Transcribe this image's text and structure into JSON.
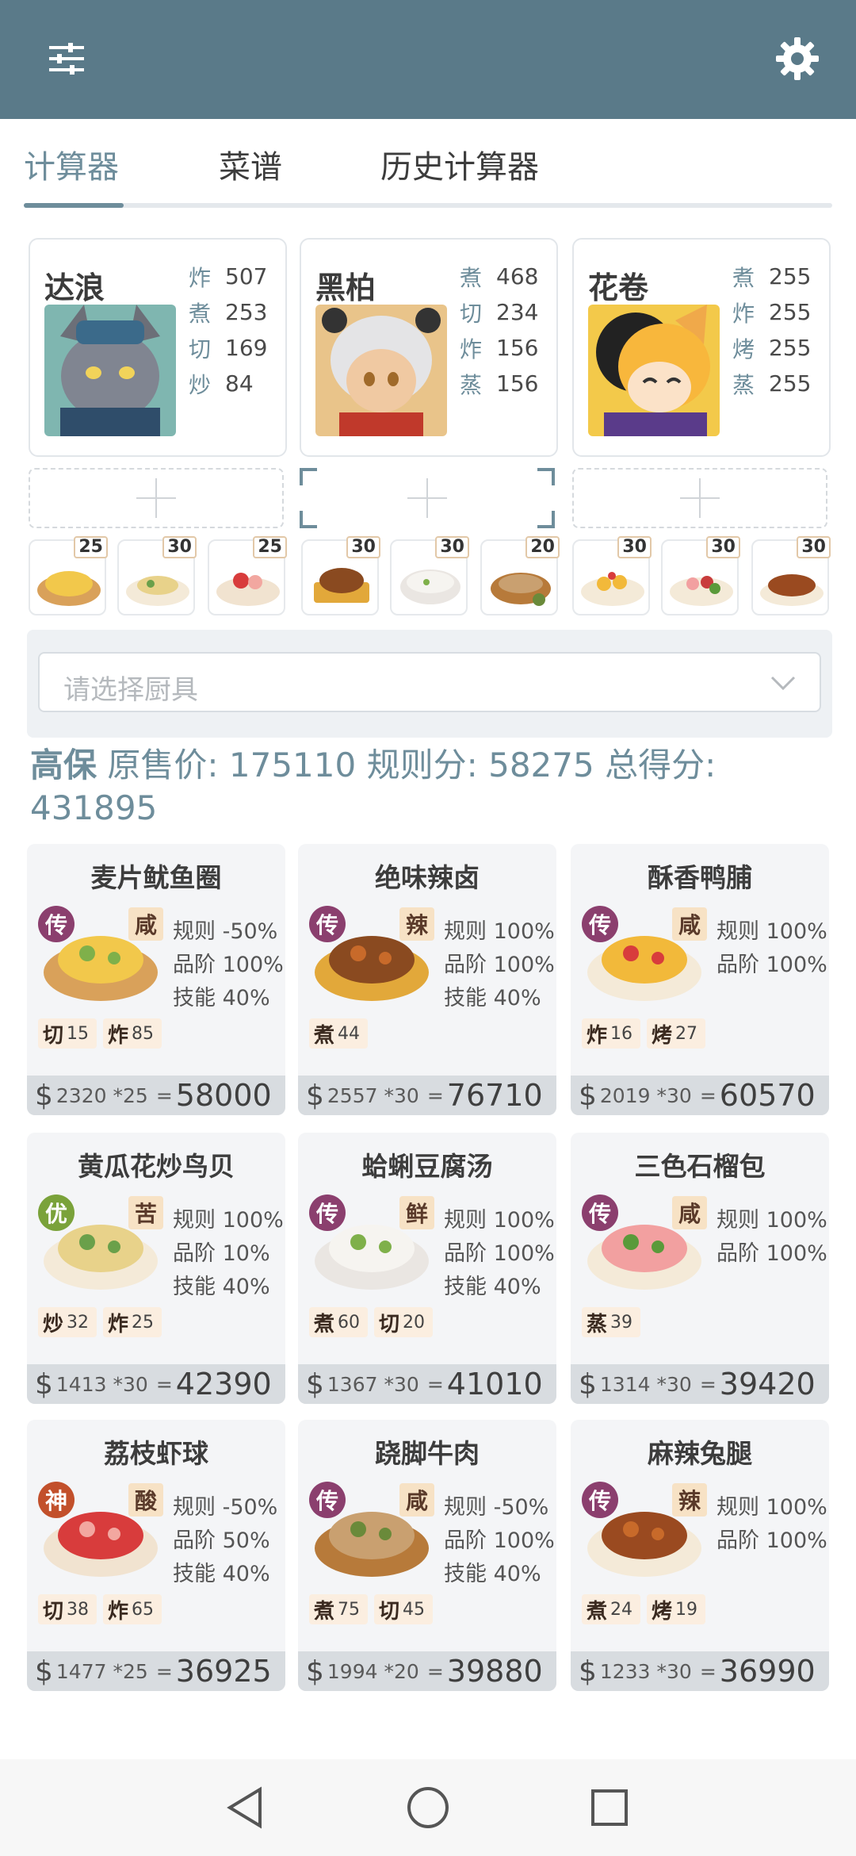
{
  "tabs": [
    {
      "label": "计算器"
    },
    {
      "label": "菜谱"
    },
    {
      "label": "历史计算器"
    }
  ],
  "chefs": [
    {
      "name": "达浪",
      "stats": [
        {
          "k": "炸",
          "v": "507"
        },
        {
          "k": "煮",
          "v": "253"
        },
        {
          "k": "切",
          "v": "169"
        },
        {
          "k": "炒",
          "v": "84"
        }
      ]
    },
    {
      "name": "黑柏",
      "stats": [
        {
          "k": "煮",
          "v": "468"
        },
        {
          "k": "切",
          "v": "234"
        },
        {
          "k": "炸",
          "v": "156"
        },
        {
          "k": "蒸",
          "v": "156"
        }
      ]
    },
    {
      "name": "花卷",
      "stats": [
        {
          "k": "煮",
          "v": "255"
        },
        {
          "k": "炸",
          "v": "255"
        },
        {
          "k": "烤",
          "v": "255"
        },
        {
          "k": "蒸",
          "v": "255"
        }
      ]
    }
  ],
  "dish_counts": [
    "25",
    "30",
    "25",
    "30",
    "30",
    "20",
    "30",
    "30",
    "30"
  ],
  "select": {
    "placeholder": "请选择厨具"
  },
  "summary": {
    "level": "高保",
    "orig_label": "原售价:",
    "orig_value": "175110",
    "rule_label": "规则分:",
    "rule_value": "58275",
    "total_label": "总得分:",
    "total_value": "431895"
  },
  "recipes": [
    {
      "title": "麦片鱿鱼圈",
      "rarity": "传",
      "flavor": "咸",
      "rules": [
        "规则 -50%",
        "品阶 100%",
        "技能 40%"
      ],
      "skills": [
        {
          "k": "切",
          "v": "15"
        },
        {
          "k": "炸",
          "v": "85"
        }
      ],
      "dollar": "$",
      "price": "2320",
      "qty": "*25",
      "eq": "=",
      "total": "58000"
    },
    {
      "title": "绝味辣卤",
      "rarity": "传",
      "flavor": "辣",
      "rules": [
        "规则 100%",
        "品阶 100%",
        "技能 40%"
      ],
      "skills": [
        {
          "k": "煮",
          "v": "44"
        }
      ],
      "dollar": "$",
      "price": "2557",
      "qty": "*30",
      "eq": "=",
      "total": "76710"
    },
    {
      "title": "酥香鸭脯",
      "rarity": "传",
      "flavor": "咸",
      "rules": [
        "规则 100%",
        "品阶 100%"
      ],
      "skills": [
        {
          "k": "炸",
          "v": "16"
        },
        {
          "k": "烤",
          "v": "27"
        }
      ],
      "dollar": "$",
      "price": "2019",
      "qty": "*30",
      "eq": "=",
      "total": "60570"
    },
    {
      "title": "黄瓜花炒鸟贝",
      "rarity": "优",
      "flavor": "苦",
      "rules": [
        "规则 100%",
        "品阶 10%",
        "技能 40%"
      ],
      "skills": [
        {
          "k": "炒",
          "v": "32"
        },
        {
          "k": "炸",
          "v": "25"
        }
      ],
      "dollar": "$",
      "price": "1413",
      "qty": "*30",
      "eq": "=",
      "total": "42390"
    },
    {
      "title": "蛤蜊豆腐汤",
      "rarity": "传",
      "flavor": "鲜",
      "rules": [
        "规则 100%",
        "品阶 100%",
        "技能 40%"
      ],
      "skills": [
        {
          "k": "煮",
          "v": "60"
        },
        {
          "k": "切",
          "v": "20"
        }
      ],
      "dollar": "$",
      "price": "1367",
      "qty": "*30",
      "eq": "=",
      "total": "41010"
    },
    {
      "title": "三色石榴包",
      "rarity": "传",
      "flavor": "咸",
      "rules": [
        "规则 100%",
        "品阶 100%"
      ],
      "skills": [
        {
          "k": "蒸",
          "v": "39"
        }
      ],
      "dollar": "$",
      "price": "1314",
      "qty": "*30",
      "eq": "=",
      "total": "39420"
    },
    {
      "title": "荔枝虾球",
      "rarity": "神",
      "flavor": "酸",
      "rules": [
        "规则 -50%",
        "品阶 50%",
        "技能 40%"
      ],
      "skills": [
        {
          "k": "切",
          "v": "38"
        },
        {
          "k": "炸",
          "v": "65"
        }
      ],
      "dollar": "$",
      "price": "1477",
      "qty": "*25",
      "eq": "=",
      "total": "36925"
    },
    {
      "title": "跷脚牛肉",
      "rarity": "传",
      "flavor": "咸",
      "rules": [
        "规则 -50%",
        "品阶 100%",
        "技能 40%"
      ],
      "skills": [
        {
          "k": "煮",
          "v": "75"
        },
        {
          "k": "切",
          "v": "45"
        }
      ],
      "dollar": "$",
      "price": "1994",
      "qty": "*20",
      "eq": "=",
      "total": "39880"
    },
    {
      "title": "麻辣兔腿",
      "rarity": "传",
      "flavor": "辣",
      "rules": [
        "规则 100%",
        "品阶 100%"
      ],
      "skills": [
        {
          "k": "煮",
          "v": "24"
        },
        {
          "k": "烤",
          "v": "19"
        }
      ],
      "dollar": "$",
      "price": "1233",
      "qty": "*30",
      "eq": "=",
      "total": "36990"
    }
  ],
  "colors": {
    "appbar": "#5a7a89",
    "accent": "#6e8d9b",
    "rarity_chuan": "#8b3f6e",
    "rarity_you": "#7aa23a",
    "rarity_shen": "#c2502b"
  }
}
